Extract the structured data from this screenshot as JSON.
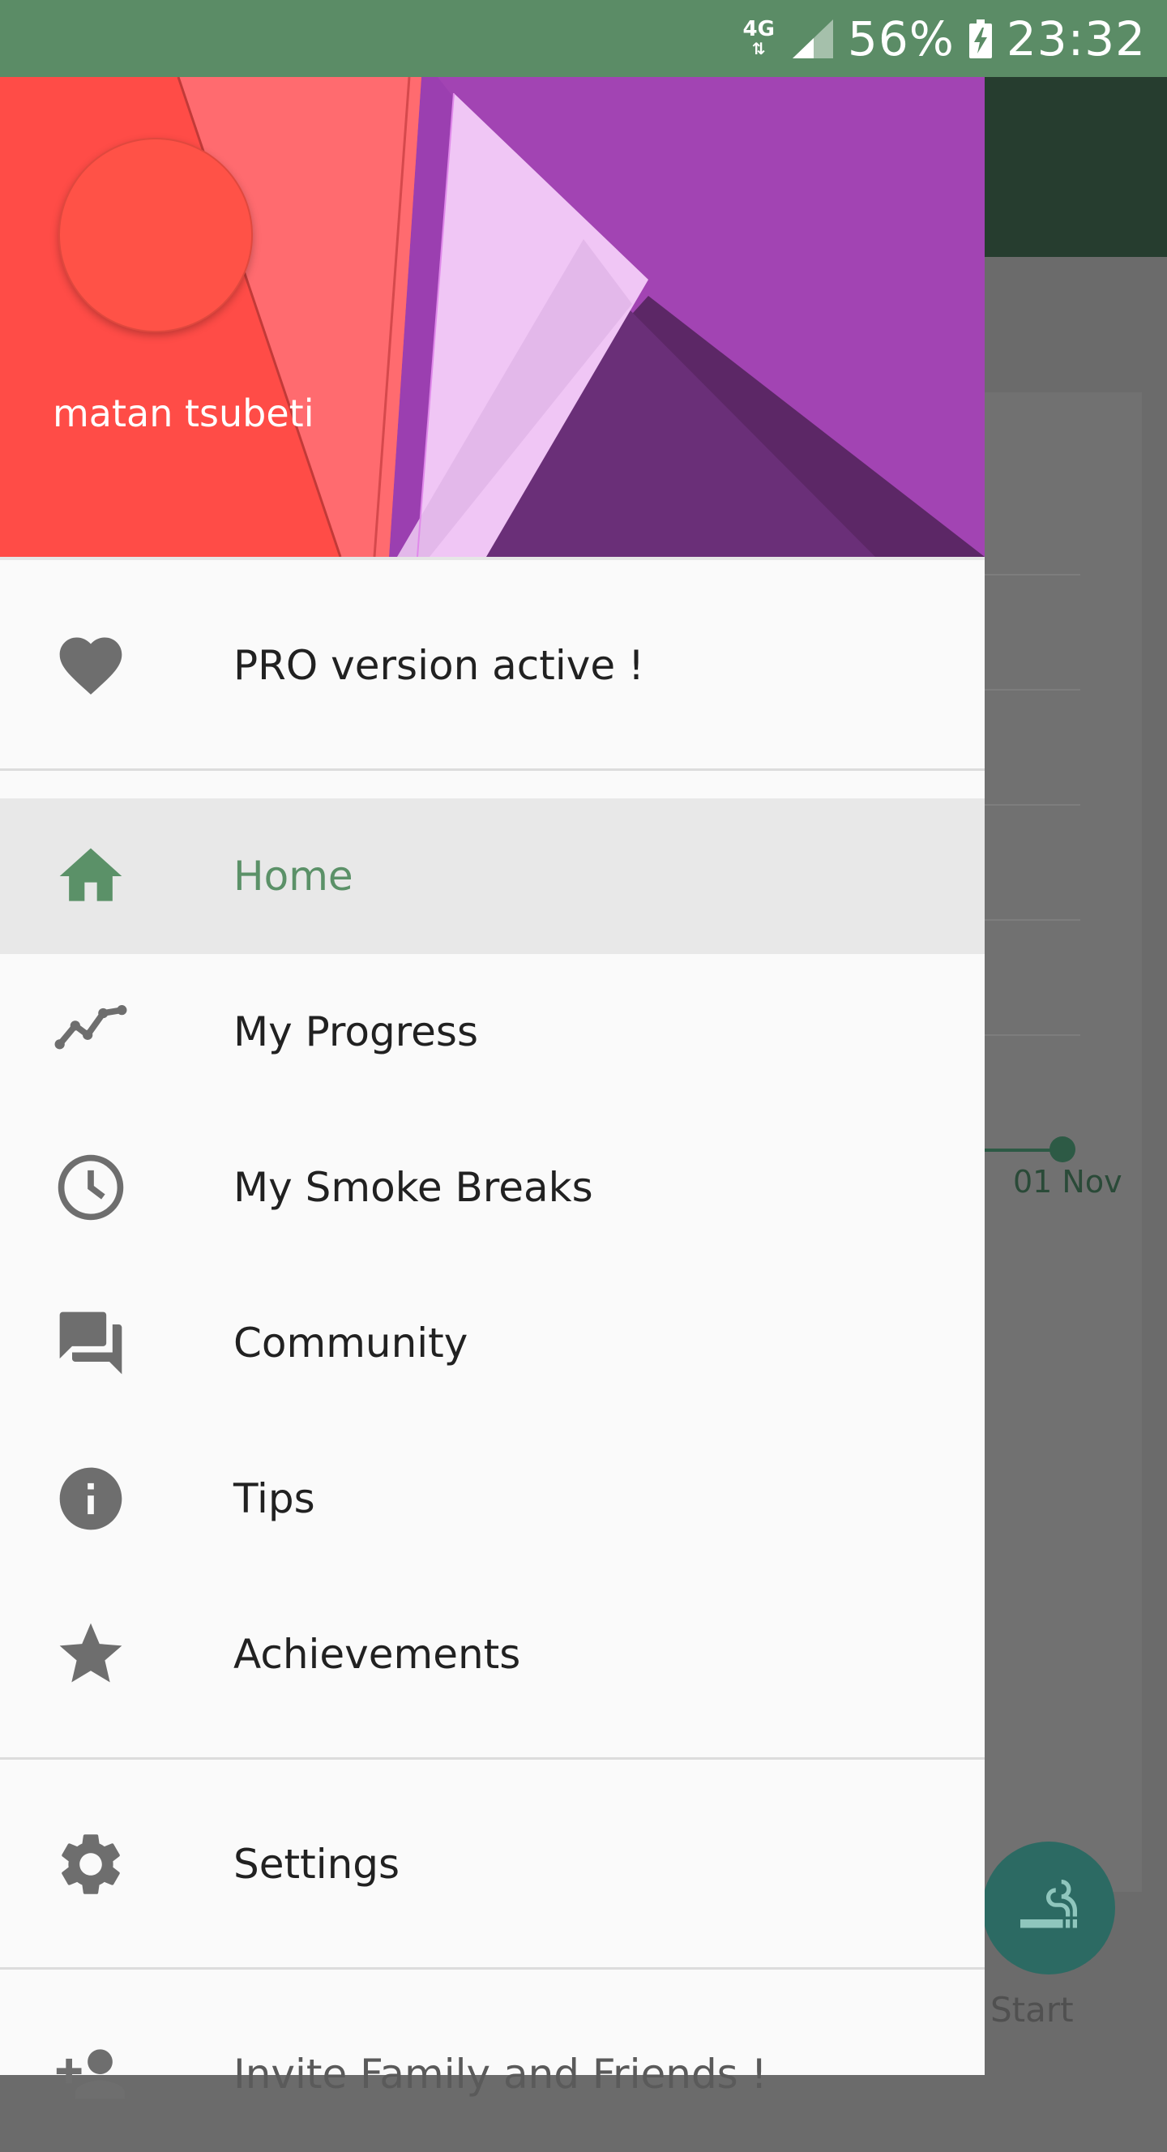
{
  "status_bar": {
    "network": "4G",
    "battery": "56%",
    "time": "23:32"
  },
  "drawer": {
    "username": "matan tsubeti",
    "pro_item": {
      "label": "PRO version active !",
      "icon": "heart-icon"
    },
    "nav_items": [
      {
        "label": "Home",
        "icon": "home-icon",
        "active": true
      },
      {
        "label": "My Progress",
        "icon": "trending-icon",
        "active": false
      },
      {
        "label": "My Smoke Breaks",
        "icon": "clock-icon",
        "active": false
      },
      {
        "label": "Community",
        "icon": "forum-icon",
        "active": false
      },
      {
        "label": "Tips",
        "icon": "info-icon",
        "active": false
      },
      {
        "label": "Achievements",
        "icon": "star-icon",
        "active": false
      }
    ],
    "settings_item": {
      "label": "Settings",
      "icon": "gear-icon"
    },
    "invite_item": {
      "label": "Invite Family and Friends !",
      "icon": "add-person-icon"
    }
  },
  "background_app": {
    "date_label": "01 Nov",
    "fab_label": "Start"
  },
  "colors": {
    "accent": "#5b9168",
    "status_bar": "#5b8c66",
    "icon_gray": "#6e6e6e"
  }
}
